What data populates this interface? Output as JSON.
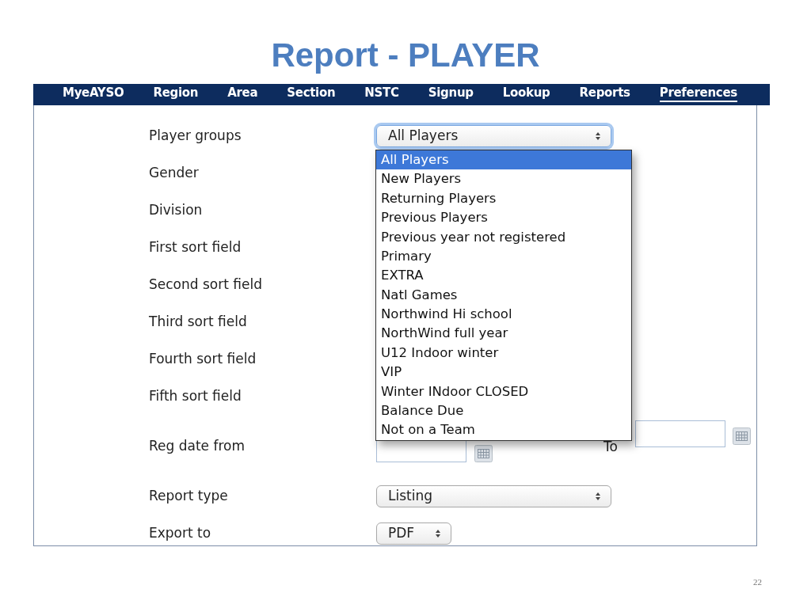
{
  "slide": {
    "title": "Report - PLAYER",
    "page_number": "22"
  },
  "nav": [
    {
      "label": "MyeAYSO",
      "selected": false
    },
    {
      "label": "Region",
      "selected": false
    },
    {
      "label": "Area",
      "selected": false
    },
    {
      "label": "Section",
      "selected": false
    },
    {
      "label": "NSTC",
      "selected": false
    },
    {
      "label": "Signup",
      "selected": false
    },
    {
      "label": "Lookup",
      "selected": false
    },
    {
      "label": "Reports",
      "selected": false
    },
    {
      "label": "Preferences",
      "selected": true
    }
  ],
  "form": [
    {
      "kind": "select",
      "label": "Player groups",
      "value": "All Players"
    },
    {
      "kind": "label",
      "label": "Gender"
    },
    {
      "kind": "label",
      "label": "Division"
    },
    {
      "kind": "label",
      "label": "First sort field"
    },
    {
      "kind": "label",
      "label": "Second sort field"
    },
    {
      "kind": "label",
      "label": "Third sort field"
    },
    {
      "kind": "label",
      "label": "Fourth sort field"
    },
    {
      "kind": "label",
      "label": "Fifth sort field"
    },
    {
      "kind": "date",
      "label": "Reg date from",
      "to_label": "To"
    },
    {
      "kind": "select",
      "label": "Report type",
      "value": "Listing"
    },
    {
      "kind": "compact_select",
      "label": "Export to",
      "value": "PDF"
    }
  ],
  "dropdown": {
    "options": [
      {
        "label": "All Players",
        "selected": true
      },
      {
        "label": "New Players",
        "selected": false
      },
      {
        "label": "Returning Players",
        "selected": false
      },
      {
        "label": "Previous Players",
        "selected": false
      },
      {
        "label": "Previous year not registered",
        "selected": false
      },
      {
        "label": "Primary",
        "selected": false
      },
      {
        "label": "EXTRA",
        "selected": false
      },
      {
        "label": "Natl Games",
        "selected": false
      },
      {
        "label": "Northwind Hi school",
        "selected": false
      },
      {
        "label": "NorthWind full year",
        "selected": false
      },
      {
        "label": "U12 Indoor winter",
        "selected": false
      },
      {
        "label": "VIP",
        "selected": false
      },
      {
        "label": "Winter INdoor CLOSED",
        "selected": false
      },
      {
        "label": "Balance Due",
        "selected": false
      },
      {
        "label": "Not on a Team",
        "selected": false
      }
    ]
  }
}
